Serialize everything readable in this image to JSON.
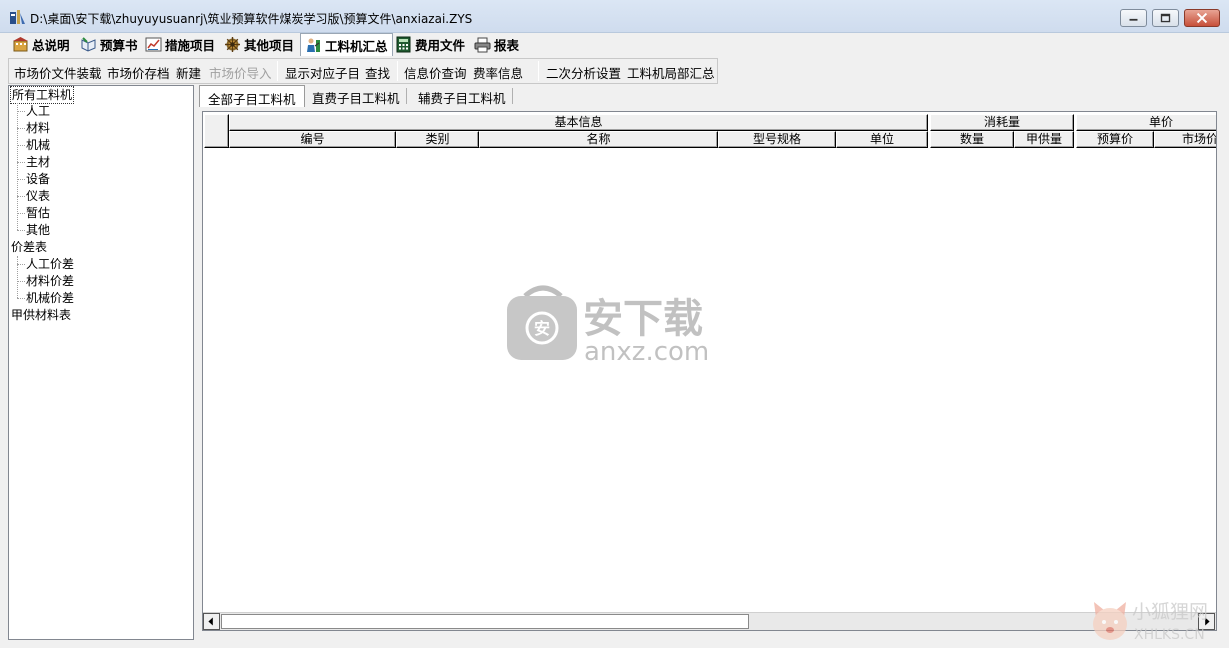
{
  "window": {
    "title": "D:\\桌面\\安下载\\zhuyuyusuanrj\\筑业预算软件煤炭学习版\\预算文件\\anxiazai.ZYS",
    "controls": [
      "minimize",
      "maximize",
      "close"
    ]
  },
  "main_tabs": [
    {
      "label": "总说明",
      "icon": "building-icon"
    },
    {
      "label": "预算书",
      "icon": "book-icon"
    },
    {
      "label": "措施项目",
      "icon": "chart-icon"
    },
    {
      "label": "其他项目",
      "icon": "gear-icon"
    },
    {
      "label": "工料机汇总",
      "icon": "worker-icon",
      "active": true
    },
    {
      "label": "费用文件",
      "icon": "calculator-icon"
    },
    {
      "label": "报表",
      "icon": "printer-icon"
    }
  ],
  "sub_toolbar": {
    "buttons": [
      {
        "label": "市场价文件装载"
      },
      {
        "label": "市场价存档"
      },
      {
        "label": "新建"
      },
      {
        "label": "市场价导入",
        "disabled": true
      },
      {
        "label": "显示对应子目"
      },
      {
        "label": "查找"
      },
      {
        "label": "信息价查询"
      },
      {
        "label": "费率信息"
      },
      {
        "label": "二次分析设置"
      },
      {
        "label": "工料机局部汇总"
      }
    ]
  },
  "tree": {
    "root1": "所有工料机",
    "root1_children": [
      "人工",
      "材料",
      "机械",
      "主材",
      "设备",
      "仪表",
      "暂估",
      "其他"
    ],
    "root2": "价差表",
    "root2_children": [
      "人工价差",
      "材料价差",
      "机械价差"
    ],
    "root3": "甲供材料表"
  },
  "sub_tabs": [
    {
      "label": "全部子目工料机",
      "active": true
    },
    {
      "label": "直费子目工料机"
    },
    {
      "label": "辅费子目工料机"
    }
  ],
  "grid": {
    "groups": {
      "basic": "基本信息",
      "consumption": "消耗量",
      "unit_price": "单价"
    },
    "columns": {
      "code": "编号",
      "category": "类别",
      "name": "名称",
      "spec": "型号规格",
      "unit": "单位",
      "quantity": "数量",
      "owner_supplied": "甲供量",
      "budget_price": "预算价",
      "market_price": "市场价"
    },
    "rows": []
  },
  "watermarks": {
    "center_cn": "安下载",
    "center_en": "anxz.com",
    "corner_cn": "小狐狸网",
    "corner_en": "XHLKS.CN"
  }
}
